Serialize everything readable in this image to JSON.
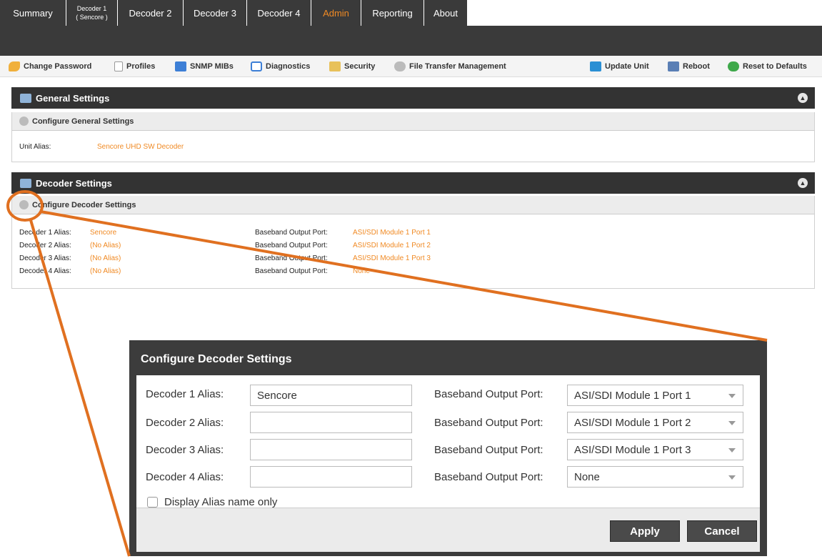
{
  "tabs": [
    {
      "label": "Summary"
    },
    {
      "label": "Decoder 1",
      "sub": "( Sencore )"
    },
    {
      "label": "Decoder 2"
    },
    {
      "label": "Decoder 3"
    },
    {
      "label": "Decoder 4"
    },
    {
      "label": "Admin",
      "active": true
    },
    {
      "label": "Reporting"
    },
    {
      "label": "About"
    }
  ],
  "toolbar": {
    "change_password": "Change Password",
    "profiles": "Profiles",
    "snmp_mibs": "SNMP MIBs",
    "diagnostics": "Diagnostics",
    "security": "Security",
    "file_transfer": "File Transfer Management",
    "update_unit": "Update Unit",
    "reboot": "Reboot",
    "reset_defaults": "Reset to Defaults"
  },
  "general": {
    "title": "General Settings",
    "configure": "Configure General Settings",
    "unit_alias_label": "Unit Alias:",
    "unit_alias_value": "Sencore UHD SW Decoder"
  },
  "decoder": {
    "title": "Decoder Settings",
    "configure": "Configure Decoder Settings",
    "rows": [
      {
        "alias_label": "Decoder 1 Alias:",
        "alias_value": "Sencore",
        "port_label": "Baseband Output Port:",
        "port_value": "ASI/SDI Module 1 Port 1"
      },
      {
        "alias_label": "Decoder 2 Alias:",
        "alias_value": "(No Alias)",
        "port_label": "Baseband Output Port:",
        "port_value": "ASI/SDI Module 1 Port 2"
      },
      {
        "alias_label": "Decoder 3 Alias:",
        "alias_value": "(No Alias)",
        "port_label": "Baseband Output Port:",
        "port_value": "ASI/SDI Module 1 Port 3"
      },
      {
        "alias_label": "Decoder 4 Alias:",
        "alias_value": "(No Alias)",
        "port_label": "Baseband Output Port:",
        "port_value": "None"
      }
    ]
  },
  "dialog": {
    "title": "Configure Decoder Settings",
    "rows": [
      {
        "alias_label": "Decoder 1 Alias:",
        "alias_value": "Sencore",
        "port_label": "Baseband Output Port:",
        "port_value": "ASI/SDI Module 1 Port 1"
      },
      {
        "alias_label": "Decoder 2 Alias:",
        "alias_value": "",
        "port_label": "Baseband Output Port:",
        "port_value": "ASI/SDI Module 1 Port 2"
      },
      {
        "alias_label": "Decoder 3 Alias:",
        "alias_value": "",
        "port_label": "Baseband Output Port:",
        "port_value": "ASI/SDI Module 1 Port 3"
      },
      {
        "alias_label": "Decoder 4 Alias:",
        "alias_value": "",
        "port_label": "Baseband Output Port:",
        "port_value": "None"
      }
    ],
    "display_alias_only": "Display Alias name only",
    "apply": "Apply",
    "cancel": "Cancel"
  },
  "colors": {
    "accent": "#f08a24",
    "callout": "#e07020",
    "dark": "#3a3a3a"
  }
}
